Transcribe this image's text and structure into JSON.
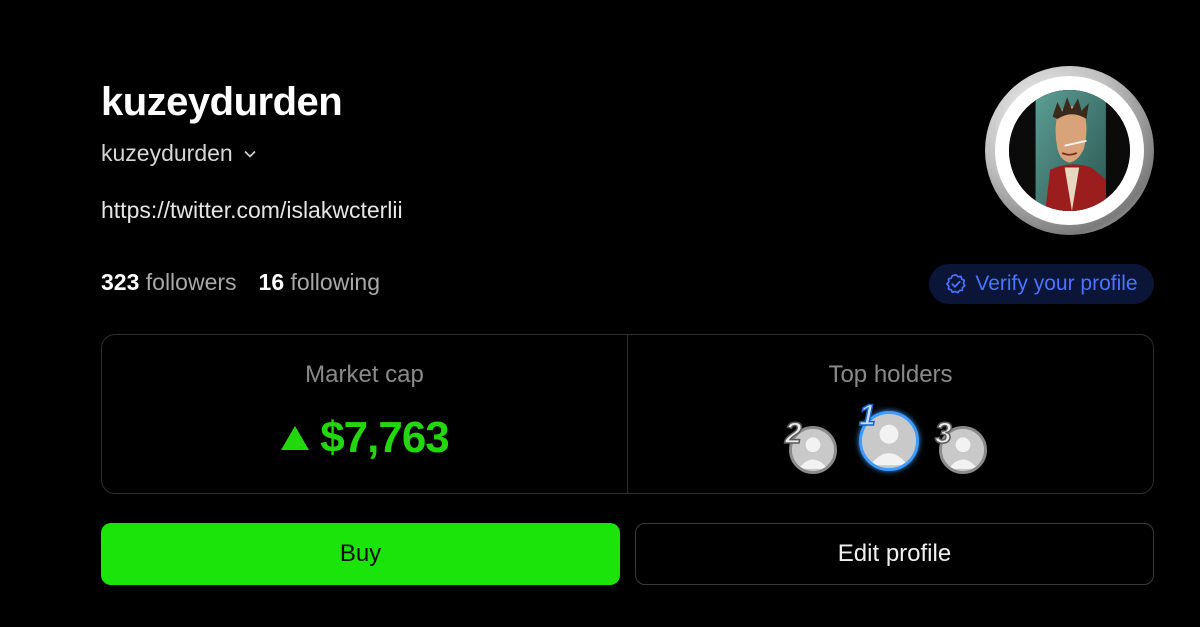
{
  "profile": {
    "display_name": "kuzeydurden",
    "handle": "kuzeydurden",
    "link": "https://twitter.com/islakwcterlii",
    "followers_count": "323",
    "followers_label": "followers",
    "following_count": "16",
    "following_label": "following",
    "verify_label": "Verify your profile"
  },
  "market": {
    "title": "Market cap",
    "value": "$7,763",
    "trend": "up",
    "color": "#23d70d"
  },
  "holders": {
    "title": "Top holders",
    "ranks": [
      "1",
      "2",
      "3"
    ]
  },
  "actions": {
    "buy_label": "Buy",
    "edit_label": "Edit profile"
  },
  "colors": {
    "background": "#000000",
    "buy": "#1ae40a",
    "verify_text": "#4b73ff",
    "verify_bg": "#0a1538"
  }
}
